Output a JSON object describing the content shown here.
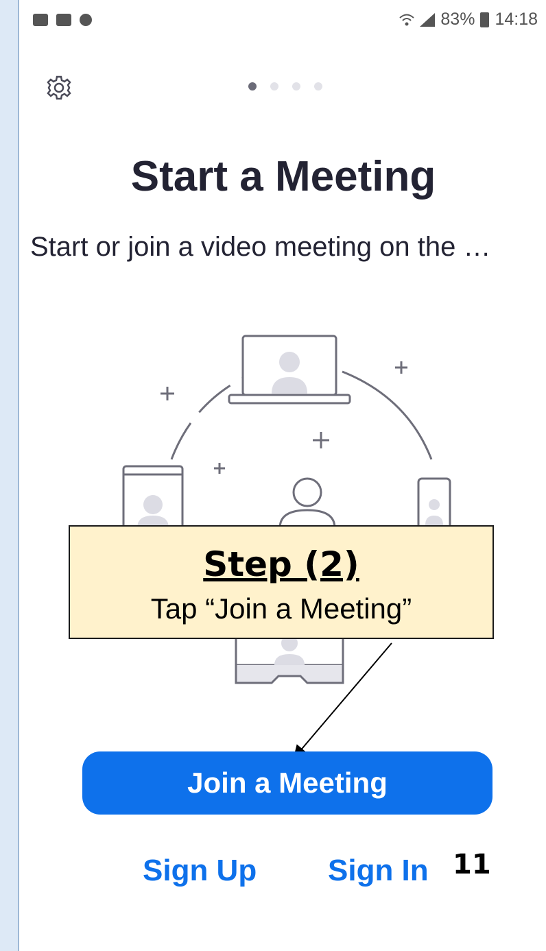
{
  "status_bar": {
    "battery": "83%",
    "time": "14:18"
  },
  "carousel": {
    "page_count": 4,
    "active_index": 0
  },
  "main": {
    "title": "Start a Meeting",
    "subtitle": "Start or join a video meeting on the …"
  },
  "callout": {
    "title": " Step (2)",
    "text": "Tap “Join a Meeting”"
  },
  "actions": {
    "join_label": "Join a Meeting",
    "signup_label": "Sign Up",
    "signin_label": "Sign In"
  },
  "page_number": "11",
  "colors": {
    "accent": "#0e71eb",
    "callout_bg": "#fff2cc",
    "title_text": "#232333"
  },
  "icons": [
    "gallery-icon",
    "lazada-icon",
    "hangouts-icon",
    "wifi-icon",
    "signal-icon",
    "battery-icon",
    "gear-icon"
  ]
}
